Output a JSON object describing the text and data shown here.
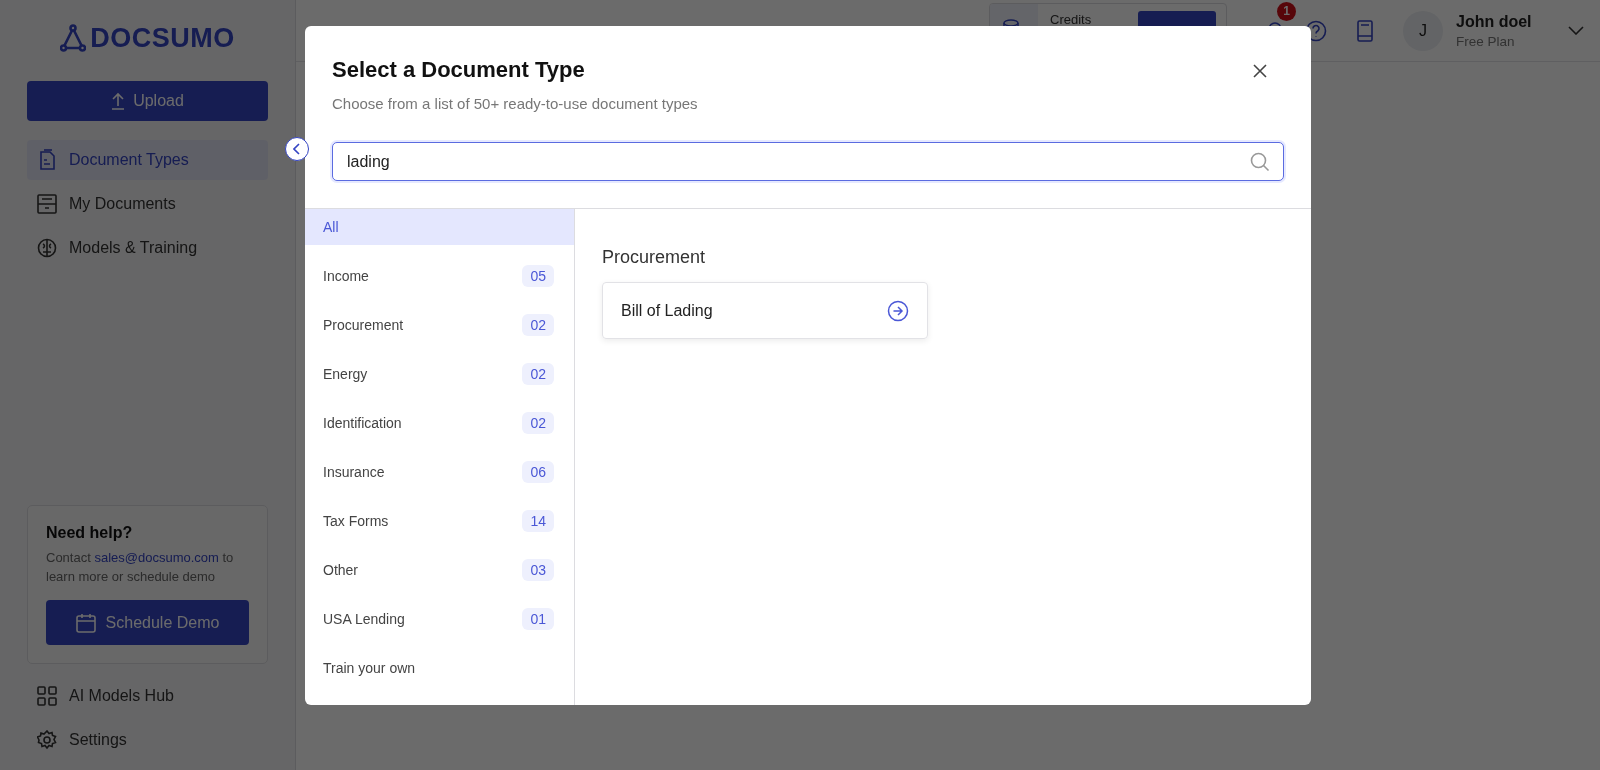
{
  "sidebar": {
    "logo": "DOCSUMO",
    "upload_button": "Upload",
    "nav": [
      {
        "label": "Document Types",
        "selected": true
      },
      {
        "label": "My Documents",
        "selected": false
      },
      {
        "label": "Models & Training",
        "selected": false
      }
    ],
    "help": {
      "title": "Need help?",
      "text_before": "Contact",
      "email": "sales@docsumo.com",
      "text_after": "to learn more or schedule demo",
      "button": "Schedule Demo"
    },
    "bottom_nav": [
      {
        "label": "AI Models Hub"
      },
      {
        "label": "Settings"
      }
    ]
  },
  "header": {
    "credits_label": "Credits",
    "notification_count": "1",
    "user": {
      "initial": "J",
      "name": "John doel",
      "plan": "Free Plan"
    }
  },
  "modal": {
    "title": "Select a Document Type",
    "subtitle": "Choose from a list of 50+ ready-to-use document types",
    "search": {
      "value": "lading"
    },
    "categories": [
      {
        "label": "All",
        "selected": true
      },
      {
        "label": "Income",
        "count": "05",
        "selected": false
      },
      {
        "label": "Procurement",
        "count": "02",
        "selected": false
      },
      {
        "label": "Energy",
        "count": "02",
        "selected": false
      },
      {
        "label": "Identification",
        "count": "02",
        "selected": false
      },
      {
        "label": "Insurance",
        "count": "06",
        "selected": false
      },
      {
        "label": "Tax Forms",
        "count": "14",
        "selected": false
      },
      {
        "label": "Other",
        "count": "03",
        "selected": false
      },
      {
        "label": "USA Lending",
        "count": "01",
        "selected": false
      },
      {
        "label": "Train your own",
        "selected": false
      }
    ],
    "results": [
      {
        "group": "Procurement",
        "items": [
          "Bill of Lading"
        ]
      }
    ]
  }
}
